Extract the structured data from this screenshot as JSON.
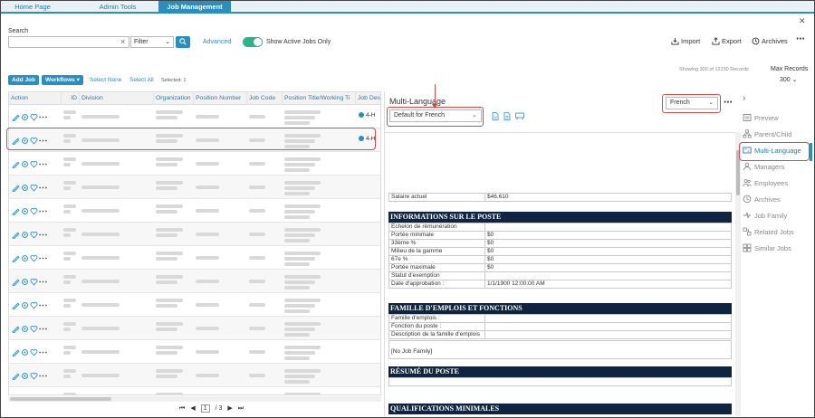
{
  "tabs": [
    {
      "label": "Home Page",
      "active": false
    },
    {
      "label": "Admin Tools",
      "active": false
    },
    {
      "label": "Job Management",
      "active": true
    }
  ],
  "search": {
    "label": "Search",
    "value": "",
    "filter_value": "Filter",
    "advanced_label": "Advanced",
    "active_only_label": "Show Active Jobs Only",
    "active_only_on": true
  },
  "toolbar": {
    "import_label": "Import",
    "export_label": "Export",
    "archives_label": "Archives",
    "add_job_label": "Add Job",
    "workflows_label": "Workflows",
    "select_none_label": "Select None",
    "select_all_label": "Select All",
    "selected_text": "Selected: 1",
    "showing_text": "Showing 300 of 12230 Records",
    "max_records_label": "Max Records",
    "max_records_value": "300"
  },
  "grid": {
    "columns": [
      "Action",
      "ID",
      "Division",
      "Organization",
      "Position Number",
      "Job Code",
      "Position Title/Working Ti",
      "Job Desc"
    ],
    "chip_label": "4-H"
  },
  "pager": {
    "current": "1",
    "total": "/ 3"
  },
  "multi_language": {
    "title": "Multi-Language",
    "template_value": "Default for French",
    "language_value": "French"
  },
  "document": {
    "salary_label": "Salaire actuel",
    "salary_value": "$46,610",
    "section1_title": "INFORMATIONS SUR LE POSTE",
    "section1_rows": [
      {
        "label": "Echelon de rémunération",
        "value": ""
      },
      {
        "label": "Portée minimale",
        "value": "$0"
      },
      {
        "label": "33ème %",
        "value": "$0"
      },
      {
        "label": "Milieu de la gamme",
        "value": "$0"
      },
      {
        "label": "67e %",
        "value": "$0"
      },
      {
        "label": "Portée maximale",
        "value": "$0"
      },
      {
        "label": "Statut d'exemption",
        "value": ""
      },
      {
        "label": "Date d'approbation :",
        "value": "1/1/1900 12:00:00 AM"
      }
    ],
    "section2_title": "FAMILLE D'EMPLOIS ET FONCTIONS",
    "section2_rows": [
      {
        "label": "Famille d'emplois :",
        "value": ""
      },
      {
        "label": "Fonction du poste :",
        "value": ""
      },
      {
        "label": "Description de la famille d'emplois",
        "value": ""
      }
    ],
    "no_family_text": "[No Job Family]",
    "section3_title": "RÉSUMÉ DU POSTE",
    "section4_title": "QUALIFICATIONS MINIMALES"
  },
  "sidebar": {
    "items": [
      {
        "label": "Preview",
        "active": false
      },
      {
        "label": "Parent/Child",
        "active": false
      },
      {
        "label": "Multi-Language",
        "active": true
      },
      {
        "label": "Managers",
        "active": false
      },
      {
        "label": "Employees",
        "active": false
      },
      {
        "label": "Archives",
        "active": false
      },
      {
        "label": "Job Family",
        "active": false
      },
      {
        "label": "Related Jobs",
        "active": false
      },
      {
        "label": "Similar Jobs",
        "active": false
      }
    ]
  },
  "colors": {
    "accent": "#2a8fc0",
    "highlight": "#d54a4a",
    "section_header": "#0e2440",
    "toggle_on": "#2bb38c"
  }
}
